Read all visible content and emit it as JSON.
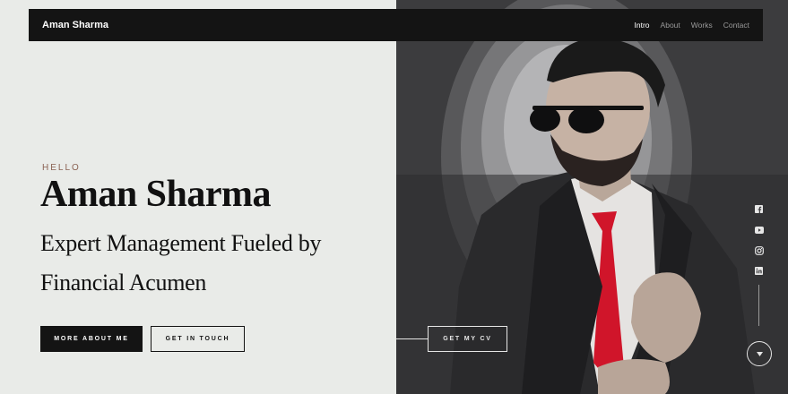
{
  "nav": {
    "brand": "Aman Sharma",
    "links": [
      {
        "label": "Intro",
        "active": true
      },
      {
        "label": "About",
        "active": false
      },
      {
        "label": "Works",
        "active": false
      },
      {
        "label": "Contact",
        "active": false
      }
    ]
  },
  "hero": {
    "greeting": "HELLO",
    "name": "Aman Sharma",
    "tagline_line1": "Expert Management Fueled by",
    "tagline_line2": "Financial Acumen"
  },
  "buttons": {
    "about": "MORE ABOUT ME",
    "touch": "GET IN TOUCH",
    "cv": "GET MY CV"
  },
  "social": [
    "facebook-icon",
    "youtube-icon",
    "instagram-icon",
    "linkedin-icon"
  ],
  "colors": {
    "left_bg": "#e9ebe8",
    "right_bg": "#3b3b3d",
    "accent": "#8a6252",
    "tie": "#d0152a",
    "dark": "#141414"
  }
}
